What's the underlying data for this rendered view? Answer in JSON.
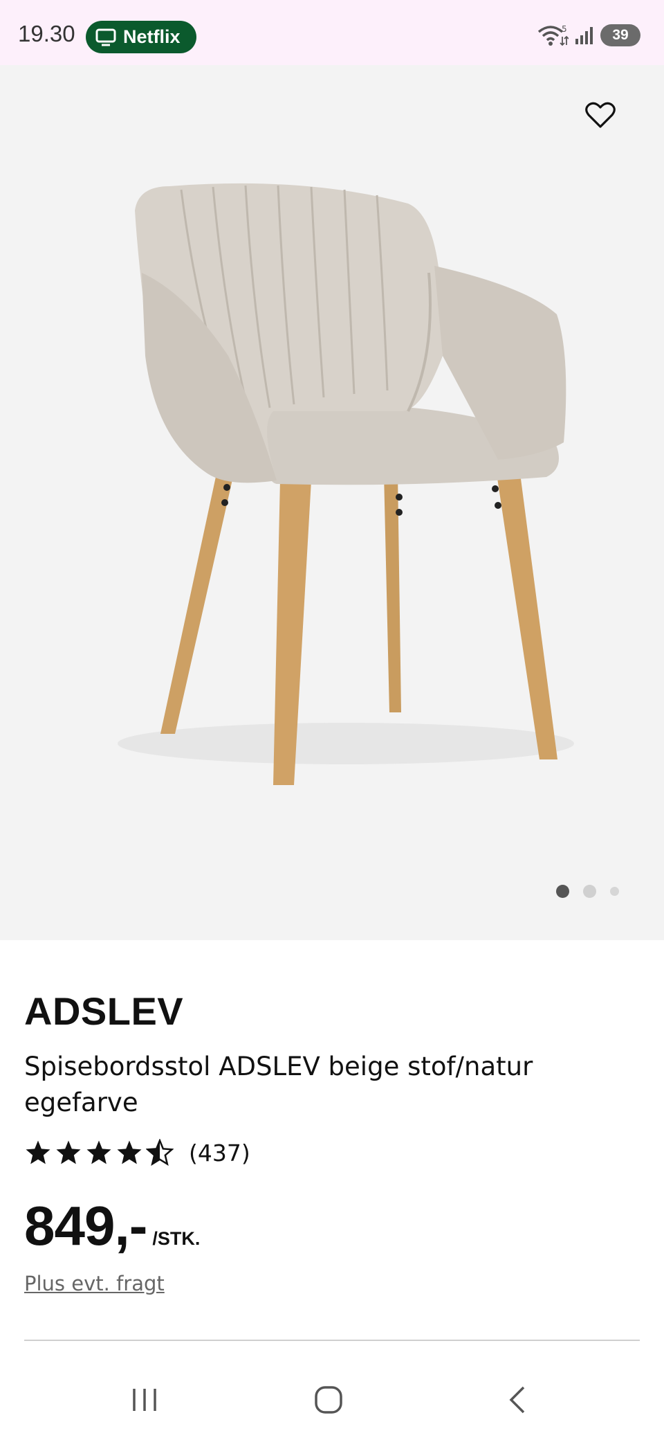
{
  "status_bar": {
    "time": "19.30",
    "notification_label": "Netflix",
    "wifi_badge": "5",
    "battery": "39"
  },
  "hero": {
    "image_description_icon": "chair-photo",
    "active_slide": 1,
    "slide_count": 3
  },
  "product": {
    "brand": "ADSLEV",
    "title": "Spisebordsstol ADSLEV beige stof/natur egefarve",
    "rating": 4.5,
    "review_count": "(437)",
    "price": "849,-",
    "unit": "/STK.",
    "shipping_note": "Plus evt. fragt"
  },
  "colors": {
    "status_bg": "#fdf0fb",
    "pill_green": "#0b5a2d",
    "hero_bg": "#f3f3f3",
    "text": "#111111"
  }
}
